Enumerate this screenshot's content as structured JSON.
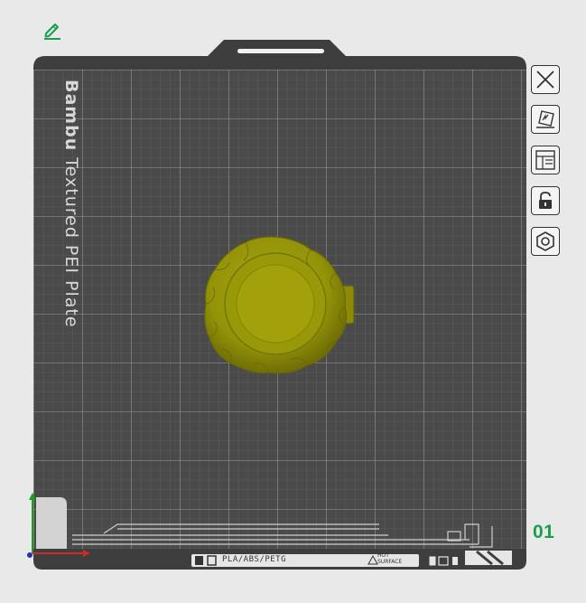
{
  "plate": {
    "name_bold": "Bambu",
    "name_rest": " Textured PEI Plate",
    "number": "01",
    "filament_types": "PLA/ABS/PETG",
    "surface_line1": "HOT",
    "surface_line2": "SURFACE"
  },
  "toolbar": {
    "edit_icon": "pencil-icon",
    "buttons": [
      {
        "name": "close",
        "icon": "close-icon"
      },
      {
        "name": "auto-orient",
        "icon": "auto-orient-icon"
      },
      {
        "name": "arrange",
        "icon": "arrange-layout-icon"
      },
      {
        "name": "lock",
        "icon": "lock-icon"
      },
      {
        "name": "settings",
        "icon": "hex-nut-icon"
      }
    ]
  },
  "colors": {
    "background": "#e9e9e9",
    "plate": "#4a4a4a",
    "grid": "#8a8a8a",
    "model": "#9b9a0d",
    "accent_green": "#1a9e4b"
  }
}
